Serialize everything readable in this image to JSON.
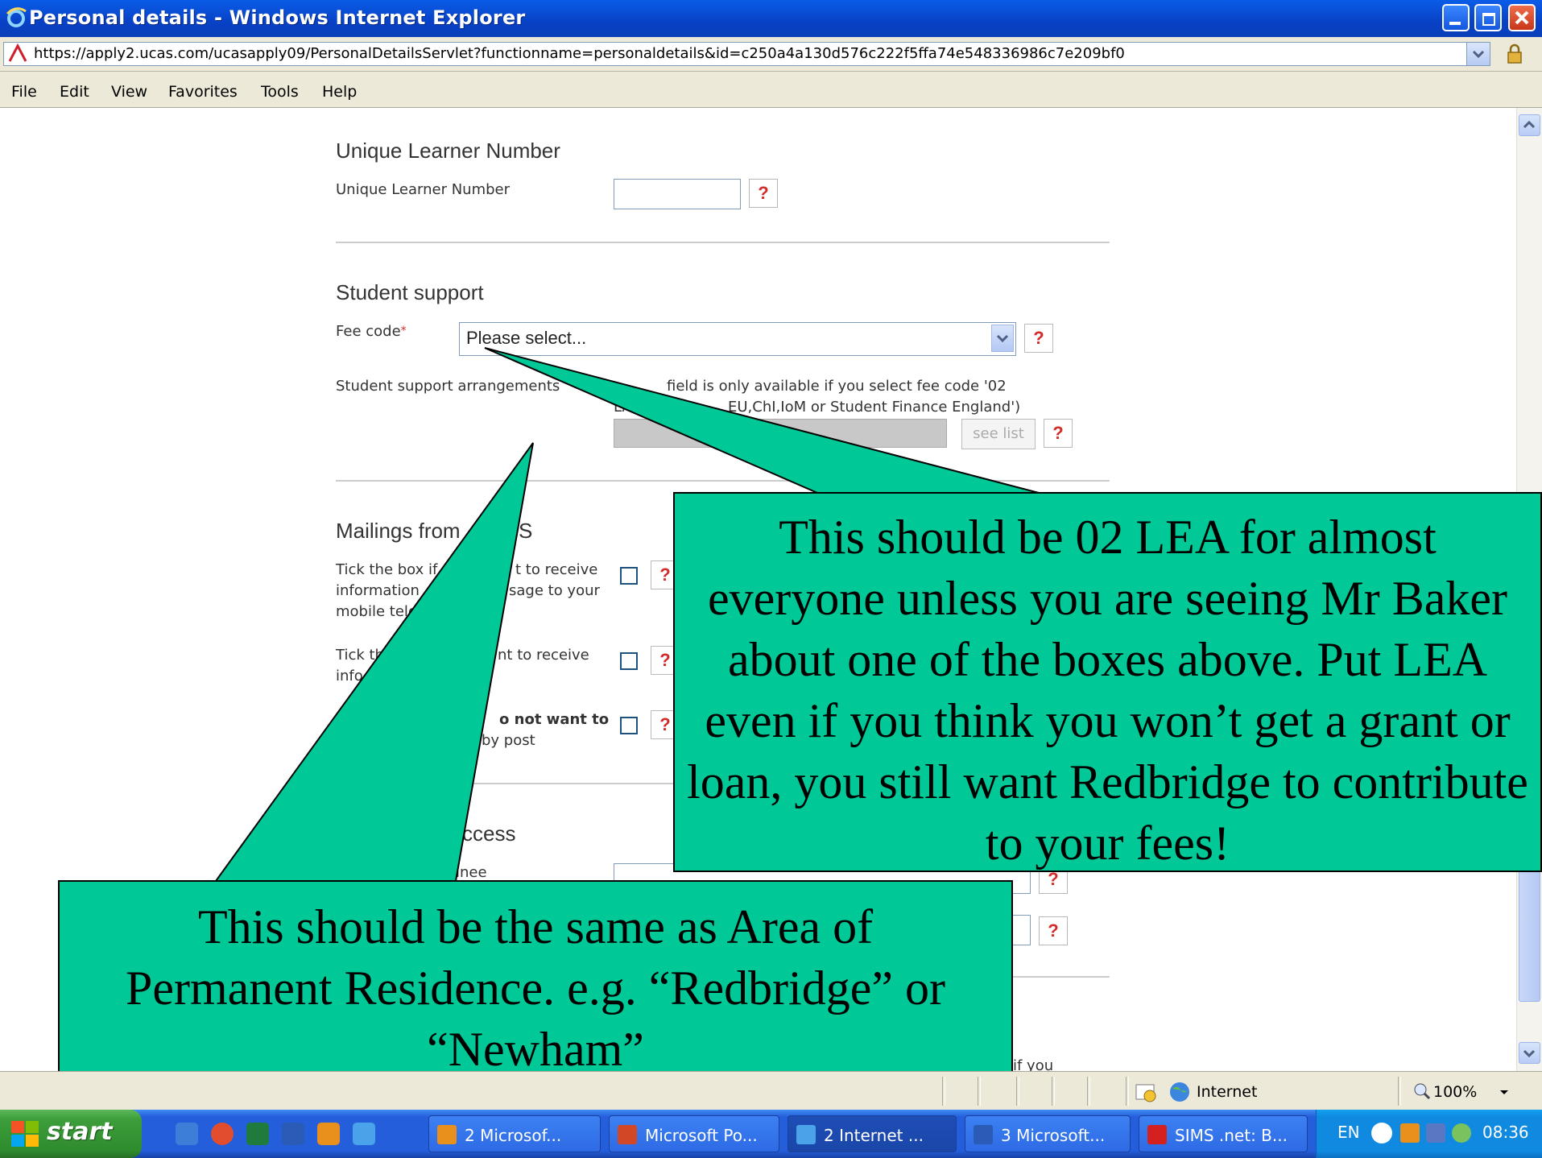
{
  "window": {
    "title": "Personal details - Windows Internet Explorer"
  },
  "address": {
    "url": "https://apply2.ucas.com/ucasapply09/PersonalDetailsServlet?functionname=personaldetails&id=c250a4a130d576c222f5ffa74e548336986c7e209bf0"
  },
  "menu": [
    "File",
    "Edit",
    "View",
    "Favorites",
    "Tools",
    "Help"
  ],
  "form": {
    "uln": {
      "section_title": "Unique Learner Number",
      "field_label": "Unique Learner Number",
      "value": "",
      "help": "?"
    },
    "support": {
      "section_title": "Student support",
      "fee_label": "Fee code",
      "fee_required_mark": "*",
      "fee_value": "Please select...",
      "arr_label": "Student support arrangements",
      "arr_note_line1": "field is only available if you select fee code '02",
      "arr_note_line2": "LA,",
      "arr_note_line2b": "EU,ChI,IoM or Student Finance England')",
      "see_list": "see list",
      "help": "?"
    },
    "mailings": {
      "section_title_start": "Mailings from",
      "section_title_end": "S",
      "opt1_line1_a": "Tick the box if",
      "opt1_line1_b": "t to receive",
      "opt1_line2_a": "information",
      "opt1_line2_b": "sage to your",
      "opt1_line3": "mobile tele",
      "opt2_line1_a": "Tick th",
      "opt2_line1_b": "nt to receive",
      "opt2_line2": "info",
      "opt3_line1": "o not want to",
      "opt3_line2": "by post",
      "help": "?"
    },
    "access": {
      "section_title_frag": "ccess",
      "label_frag": "inee",
      "help": "?"
    },
    "bottom_frag": "if you"
  },
  "callouts": {
    "right": "This should be 02 LEA for almost everyone unless you are seeing Mr Baker about one of the boxes above. Put LEA even if you think you won’t get a grant or loan, you still want Redbridge to contribute to your fees!",
    "left": "This should be the same as Area of Permanent Residence. e.g. “Redbridge” or “Newham”"
  },
  "status": {
    "zone": "Internet",
    "zoom": "100%"
  },
  "taskbar": {
    "start": "start",
    "items": [
      "2 Microsof...",
      "Microsoft Po...",
      "2 Internet ...",
      "3 Microsoft...",
      "SIMS .net: B..."
    ],
    "lang": "EN",
    "time": "08:36"
  },
  "colors": {
    "callout_fill": "#00c897",
    "xp_blue": "#245edb",
    "help_red": "#d42b2b"
  }
}
